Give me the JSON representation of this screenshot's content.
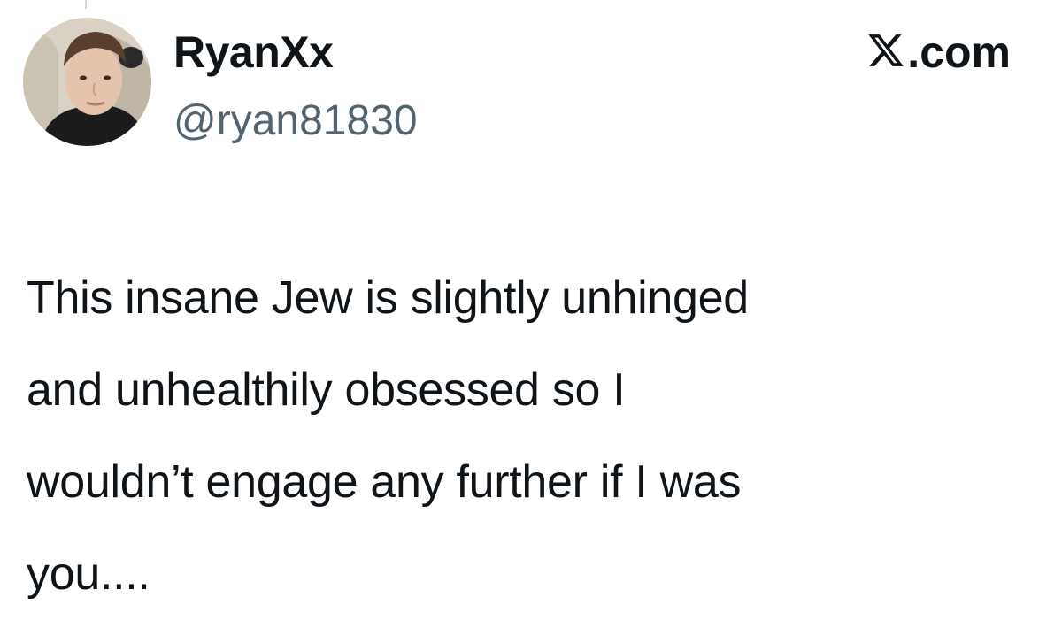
{
  "tweet": {
    "author": {
      "display_name": "RyanXx",
      "handle": "@ryan81830",
      "avatar_icon": "profile-photo"
    },
    "brand": {
      "logo_icon": "x-logo-icon",
      "domain_suffix": ".com"
    },
    "text_lines": [
      "This insane Jew is slightly unhinged",
      "and unhealthily obsessed so I",
      "wouldn’t engage any further if I was",
      "you...."
    ]
  },
  "colors": {
    "text_primary": "#0f1419",
    "text_secondary": "#536471",
    "background": "#ffffff"
  }
}
